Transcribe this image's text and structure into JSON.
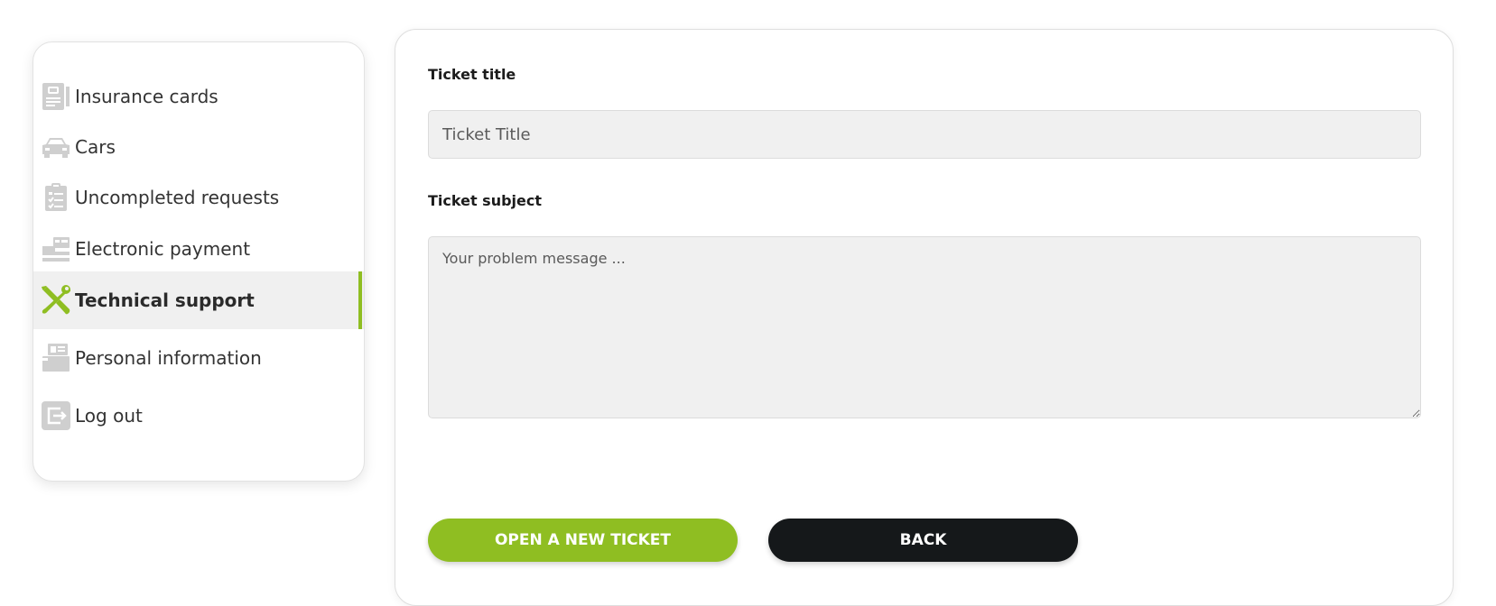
{
  "sidebar": {
    "items": [
      {
        "label": "Insurance cards",
        "icon": "insurance-card-icon"
      },
      {
        "label": "Cars",
        "icon": "car-icon"
      },
      {
        "label": "Uncompleted requests",
        "icon": "clipboard-checklist-icon"
      },
      {
        "label": "Electronic payment",
        "icon": "card-terminal-icon"
      },
      {
        "label": "Technical support",
        "icon": "tools-icon",
        "active": true
      },
      {
        "label": "Personal information",
        "icon": "id-card-icon"
      },
      {
        "label": "Log out",
        "icon": "logout-icon"
      }
    ]
  },
  "form": {
    "title_label": "Ticket title",
    "title_placeholder": "Ticket Title",
    "subject_label": "Ticket subject",
    "subject_placeholder": "Your problem message ..."
  },
  "buttons": {
    "open_ticket": "OPEN A NEW TICKET",
    "back": "BACK"
  },
  "colors": {
    "accent": "#8fbe22",
    "dark_button": "#15181a",
    "icon_gray": "#c9c9c9",
    "active_bg": "#f0f0f0"
  }
}
